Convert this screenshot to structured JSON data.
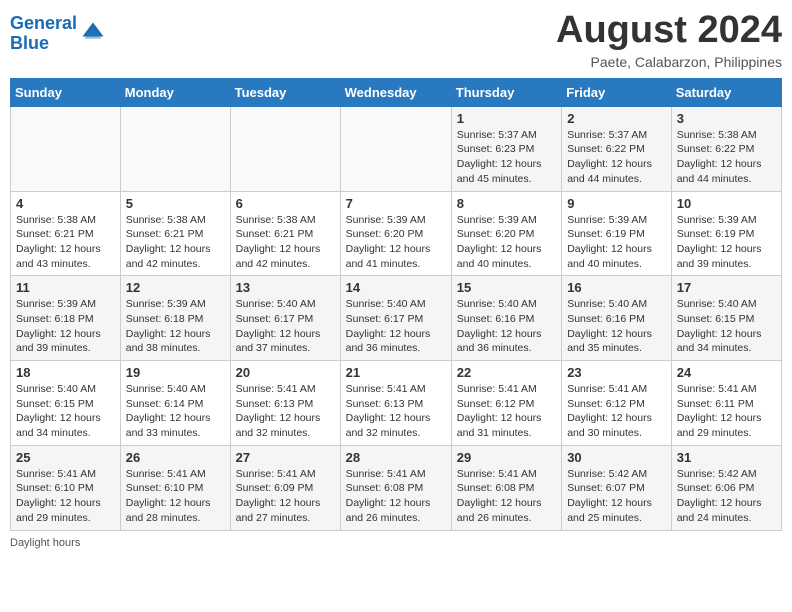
{
  "logo": {
    "line1": "General",
    "line2": "Blue"
  },
  "title": "August 2024",
  "location": "Paete, Calabarzon, Philippines",
  "weekdays": [
    "Sunday",
    "Monday",
    "Tuesday",
    "Wednesday",
    "Thursday",
    "Friday",
    "Saturday"
  ],
  "footer": "Daylight hours",
  "weeks": [
    [
      {
        "day": "",
        "info": ""
      },
      {
        "day": "",
        "info": ""
      },
      {
        "day": "",
        "info": ""
      },
      {
        "day": "",
        "info": ""
      },
      {
        "day": "1",
        "info": "Sunrise: 5:37 AM\nSunset: 6:23 PM\nDaylight: 12 hours and 45 minutes."
      },
      {
        "day": "2",
        "info": "Sunrise: 5:37 AM\nSunset: 6:22 PM\nDaylight: 12 hours and 44 minutes."
      },
      {
        "day": "3",
        "info": "Sunrise: 5:38 AM\nSunset: 6:22 PM\nDaylight: 12 hours and 44 minutes."
      }
    ],
    [
      {
        "day": "4",
        "info": "Sunrise: 5:38 AM\nSunset: 6:21 PM\nDaylight: 12 hours and 43 minutes."
      },
      {
        "day": "5",
        "info": "Sunrise: 5:38 AM\nSunset: 6:21 PM\nDaylight: 12 hours and 42 minutes."
      },
      {
        "day": "6",
        "info": "Sunrise: 5:38 AM\nSunset: 6:21 PM\nDaylight: 12 hours and 42 minutes."
      },
      {
        "day": "7",
        "info": "Sunrise: 5:39 AM\nSunset: 6:20 PM\nDaylight: 12 hours and 41 minutes."
      },
      {
        "day": "8",
        "info": "Sunrise: 5:39 AM\nSunset: 6:20 PM\nDaylight: 12 hours and 40 minutes."
      },
      {
        "day": "9",
        "info": "Sunrise: 5:39 AM\nSunset: 6:19 PM\nDaylight: 12 hours and 40 minutes."
      },
      {
        "day": "10",
        "info": "Sunrise: 5:39 AM\nSunset: 6:19 PM\nDaylight: 12 hours and 39 minutes."
      }
    ],
    [
      {
        "day": "11",
        "info": "Sunrise: 5:39 AM\nSunset: 6:18 PM\nDaylight: 12 hours and 39 minutes."
      },
      {
        "day": "12",
        "info": "Sunrise: 5:39 AM\nSunset: 6:18 PM\nDaylight: 12 hours and 38 minutes."
      },
      {
        "day": "13",
        "info": "Sunrise: 5:40 AM\nSunset: 6:17 PM\nDaylight: 12 hours and 37 minutes."
      },
      {
        "day": "14",
        "info": "Sunrise: 5:40 AM\nSunset: 6:17 PM\nDaylight: 12 hours and 36 minutes."
      },
      {
        "day": "15",
        "info": "Sunrise: 5:40 AM\nSunset: 6:16 PM\nDaylight: 12 hours and 36 minutes."
      },
      {
        "day": "16",
        "info": "Sunrise: 5:40 AM\nSunset: 6:16 PM\nDaylight: 12 hours and 35 minutes."
      },
      {
        "day": "17",
        "info": "Sunrise: 5:40 AM\nSunset: 6:15 PM\nDaylight: 12 hours and 34 minutes."
      }
    ],
    [
      {
        "day": "18",
        "info": "Sunrise: 5:40 AM\nSunset: 6:15 PM\nDaylight: 12 hours and 34 minutes."
      },
      {
        "day": "19",
        "info": "Sunrise: 5:40 AM\nSunset: 6:14 PM\nDaylight: 12 hours and 33 minutes."
      },
      {
        "day": "20",
        "info": "Sunrise: 5:41 AM\nSunset: 6:13 PM\nDaylight: 12 hours and 32 minutes."
      },
      {
        "day": "21",
        "info": "Sunrise: 5:41 AM\nSunset: 6:13 PM\nDaylight: 12 hours and 32 minutes."
      },
      {
        "day": "22",
        "info": "Sunrise: 5:41 AM\nSunset: 6:12 PM\nDaylight: 12 hours and 31 minutes."
      },
      {
        "day": "23",
        "info": "Sunrise: 5:41 AM\nSunset: 6:12 PM\nDaylight: 12 hours and 30 minutes."
      },
      {
        "day": "24",
        "info": "Sunrise: 5:41 AM\nSunset: 6:11 PM\nDaylight: 12 hours and 29 minutes."
      }
    ],
    [
      {
        "day": "25",
        "info": "Sunrise: 5:41 AM\nSunset: 6:10 PM\nDaylight: 12 hours and 29 minutes."
      },
      {
        "day": "26",
        "info": "Sunrise: 5:41 AM\nSunset: 6:10 PM\nDaylight: 12 hours and 28 minutes."
      },
      {
        "day": "27",
        "info": "Sunrise: 5:41 AM\nSunset: 6:09 PM\nDaylight: 12 hours and 27 minutes."
      },
      {
        "day": "28",
        "info": "Sunrise: 5:41 AM\nSunset: 6:08 PM\nDaylight: 12 hours and 26 minutes."
      },
      {
        "day": "29",
        "info": "Sunrise: 5:41 AM\nSunset: 6:08 PM\nDaylight: 12 hours and 26 minutes."
      },
      {
        "day": "30",
        "info": "Sunrise: 5:42 AM\nSunset: 6:07 PM\nDaylight: 12 hours and 25 minutes."
      },
      {
        "day": "31",
        "info": "Sunrise: 5:42 AM\nSunset: 6:06 PM\nDaylight: 12 hours and 24 minutes."
      }
    ]
  ]
}
